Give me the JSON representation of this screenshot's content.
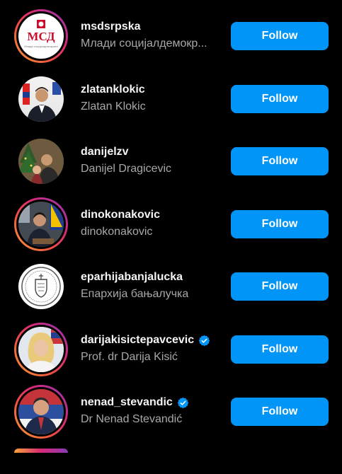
{
  "accounts": [
    {
      "username": "msdsrpska",
      "full_name": "Млади социјалдемокр...",
      "verified": false,
      "story_ring": true,
      "follow_label": "Follow",
      "logo_text": "МСД",
      "logo_subtext": "Млади социјалдемократи"
    },
    {
      "username": "zlatanklokic",
      "full_name": "Zlatan Klokic",
      "verified": false,
      "story_ring": false,
      "follow_label": "Follow"
    },
    {
      "username": "danijelzv",
      "full_name": "Danijel Dragicevic",
      "verified": false,
      "story_ring": false,
      "follow_label": "Follow"
    },
    {
      "username": "dinokonakovic",
      "full_name": "dinokonakovic",
      "verified": false,
      "story_ring": true,
      "follow_label": "Follow"
    },
    {
      "username": "eparhijabanjalucka",
      "full_name": "Епархија бањалучка",
      "verified": false,
      "story_ring": false,
      "follow_label": "Follow"
    },
    {
      "username": "darijakisictepavcevic",
      "full_name": "Prof. dr Darija Kisić",
      "verified": true,
      "story_ring": true,
      "follow_label": "Follow"
    },
    {
      "username": "nenad_stevandic",
      "full_name": "Dr Nenad Stevandić",
      "verified": true,
      "story_ring": true,
      "follow_label": "Follow"
    }
  ],
  "colors": {
    "follow_button": "#0095f6",
    "verified_badge": "#0095f6",
    "secondary_text": "#a8a8a8"
  }
}
